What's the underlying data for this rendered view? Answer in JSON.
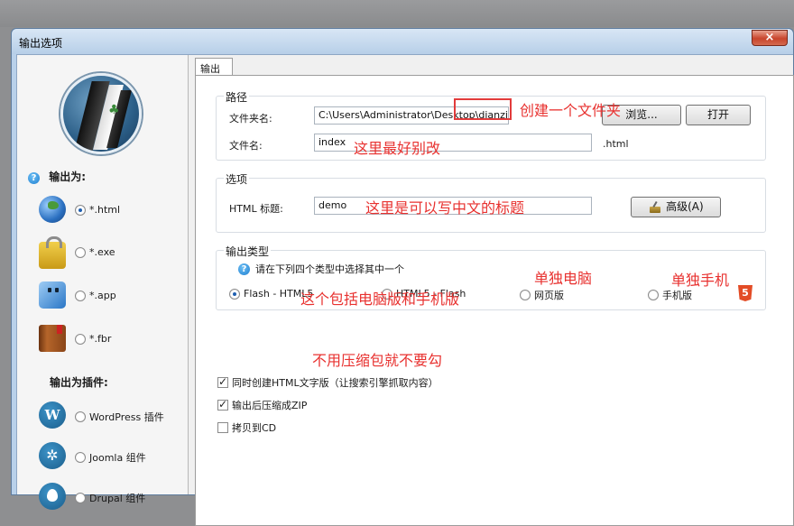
{
  "window": {
    "title": "输出选项",
    "close_label": "×"
  },
  "sidebar": {
    "output_as_label": "输出为:",
    "formats": [
      {
        "label": "*.html",
        "icon": "globe-icon",
        "selected": true
      },
      {
        "label": "*.exe",
        "icon": "lock-icon",
        "selected": false
      },
      {
        "label": "*.app",
        "icon": "mac-finder-icon",
        "selected": false
      },
      {
        "label": "*.fbr",
        "icon": "book-icon",
        "selected": false
      }
    ],
    "output_plugin_label": "输出为插件:",
    "plugins": [
      {
        "label": "WordPress 插件",
        "icon": "wordpress-icon",
        "selected": false
      },
      {
        "label": "Joomla 组件",
        "icon": "joomla-icon",
        "selected": false
      },
      {
        "label": "Drupal 组件",
        "icon": "drupal-icon",
        "selected": false
      }
    ]
  },
  "main": {
    "tab_label": "输出",
    "path": {
      "legend": "路径",
      "folder_label": "文件夹名:",
      "folder_value": "C:\\Users\\Administrator\\Desktop\\dianzishu",
      "browse_label": "浏览...",
      "open_label": "打开",
      "filename_label": "文件名:",
      "filename_value": "index",
      "extension": ".html"
    },
    "options": {
      "legend": "选项",
      "html_title_label": "HTML 标题:",
      "html_title_value": "demo",
      "advanced_label": "高级(A)"
    },
    "output_type": {
      "legend": "输出类型",
      "hint": "请在下列四个类型中选择其中一个",
      "choices": [
        {
          "label": "Flash - HTML5",
          "selected": true
        },
        {
          "label": "HTML5 - Flash",
          "selected": false
        },
        {
          "label": "网页版",
          "selected": false
        },
        {
          "label": "手机版",
          "selected": false
        }
      ],
      "html5_badge": "5"
    },
    "checks": [
      {
        "label": "同时创建HTML文字版（让搜索引擎抓取内容）",
        "checked": true
      },
      {
        "label": "输出后压缩成ZIP",
        "checked": true
      },
      {
        "label": "拷贝到CD",
        "checked": false
      }
    ]
  },
  "annotations": {
    "create_folder": "创建一个文件夹",
    "dont_change": "这里最好别改",
    "chinese_title": "这里是可以写中文的标题",
    "pc_only": "单独电脑",
    "mobile_only": "单独手机",
    "pc_and_mobile": "这个包括电脑版和手机版",
    "no_zip": "不用压缩包就不要勾"
  },
  "colors": {
    "annotation": "#e8312f",
    "titlebar": "#b9d1ea",
    "radio_dot": "#1f5fb0"
  }
}
